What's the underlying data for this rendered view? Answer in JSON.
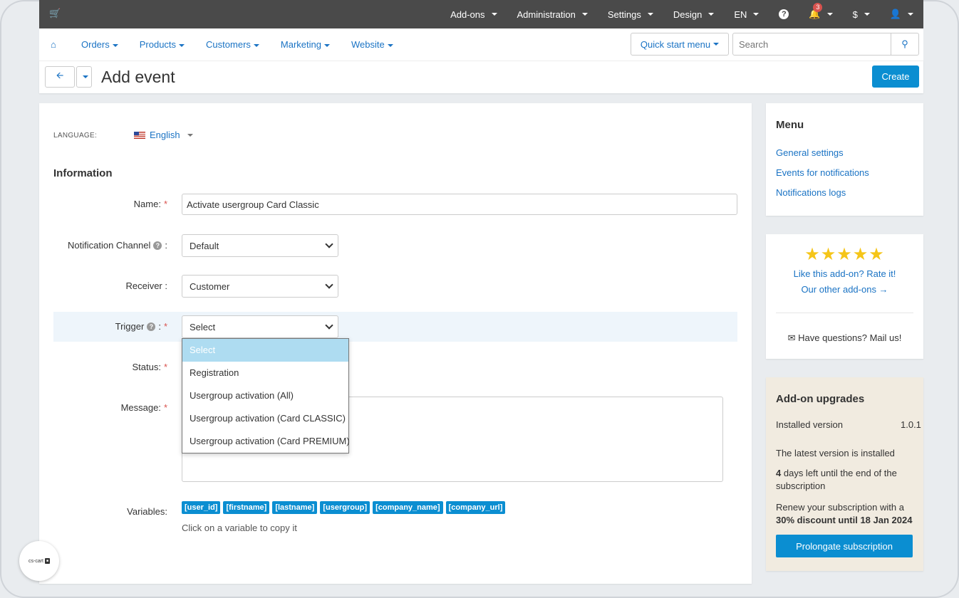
{
  "topbar": {
    "cart_icon": "cart-icon",
    "items": [
      {
        "label": "Add-ons"
      },
      {
        "label": "Administration"
      },
      {
        "label": "Settings"
      },
      {
        "label": "Design"
      },
      {
        "label": "EN"
      }
    ],
    "help_glyph": "?",
    "notifications_count": "3",
    "currency": "$"
  },
  "nav": {
    "home_icon": "home-icon",
    "items": [
      {
        "label": "Orders"
      },
      {
        "label": "Products"
      },
      {
        "label": "Customers"
      },
      {
        "label": "Marketing"
      },
      {
        "label": "Website"
      }
    ],
    "quick_start": "Quick start menu",
    "search_placeholder": "Search"
  },
  "title_bar": {
    "title": "Add event",
    "create_label": "Create"
  },
  "form": {
    "language_label": "LANGUAGE:",
    "language_value": "English",
    "section_title": "Information",
    "name_label": "Name:",
    "name_value": "Activate usergroup Card Classic",
    "channel_label": "Notification Channel",
    "channel_value": "Default",
    "receiver_label": "Receiver :",
    "receiver_value": "Customer",
    "trigger_label": "Trigger",
    "trigger_value": "Select",
    "status_label": "Status:",
    "message_label": "Message:",
    "variables_label": "Variables:",
    "variables": [
      "[user_id]",
      "[firstname]",
      "[lastname]",
      "[usergroup]",
      "[company_name]",
      "[company_url]"
    ],
    "variables_hint": "Click on a variable to copy it",
    "trigger_options": [
      "Select",
      "Registration",
      "Usergroup activation (All)",
      "Usergroup activation (Card CLASSIC)",
      "Usergroup activation (Card PREMIUM)"
    ],
    "trigger_selected_index": 0
  },
  "sidebar": {
    "menu_title": "Menu",
    "menu_links": [
      "General settings",
      "Events for notifications",
      "Notifications logs"
    ],
    "rating_stars": 5,
    "rate_link": "Like this add-on? Rate it!",
    "other_link": "Our other add-ons →",
    "mail_text": "Have questions? Mail us!",
    "upgrades_title": "Add-on upgrades",
    "installed_label": "Installed version",
    "installed_value": "1.0.1",
    "latest_text": "The latest version is installed",
    "days_count": "4",
    "days_text": "days left until the end of the subscription",
    "renew_text": "Renew your subscription with a",
    "discount_text": "30% discount until 18 Jan 2024",
    "prolong_label": "Prolongate subscription"
  },
  "logo": {
    "text": "cs-cart"
  },
  "colors": {
    "accent": "#0b8ed1",
    "topbar": "#4a4a4a",
    "link": "#1a73c4",
    "required": "#d9534f"
  }
}
